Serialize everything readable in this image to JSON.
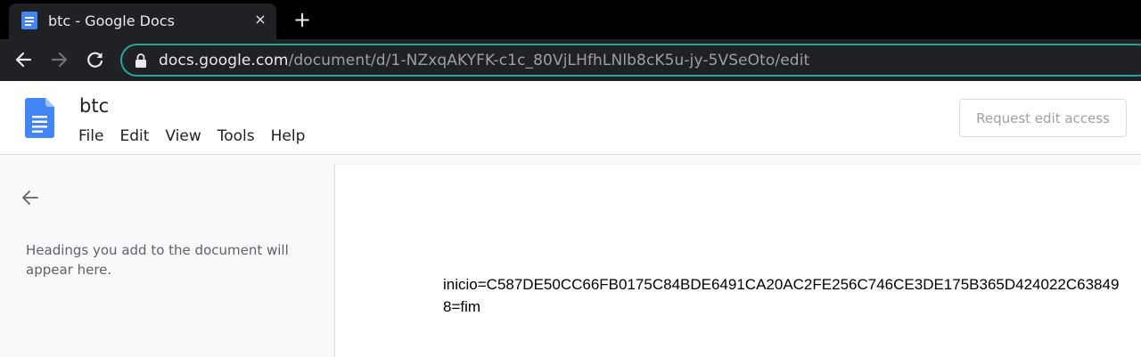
{
  "browser": {
    "tab_title": "btc - Google Docs",
    "close_glyph": "×",
    "new_tab_glyph": "+",
    "url_host": "docs.google.com",
    "url_path": "/document/d/1-NZxqAKYFK-c1c_80VjLHfhLNlb8cK5u-jy-5VSeOto/edit",
    "accent_color": "#26a69a"
  },
  "docs": {
    "title": "btc",
    "menu": [
      "File",
      "Edit",
      "View",
      "Tools",
      "Help"
    ],
    "edit_access_label": "Request edit access"
  },
  "outline": {
    "hint": "Headings you add to the document will appear here."
  },
  "document": {
    "body_text": "inicio=C587DE50CC66FB0175C84BDE6491CA20AC2FE256C746CE3DE175B365D424022C638498=fim"
  },
  "icons": {
    "favicon": "google-docs-icon",
    "back": "back-arrow-icon",
    "forward": "forward-arrow-icon",
    "reload": "reload-icon",
    "lock": "lock-icon",
    "logo": "google-docs-logo-icon",
    "outline_back": "outline-back-arrow-icon"
  }
}
